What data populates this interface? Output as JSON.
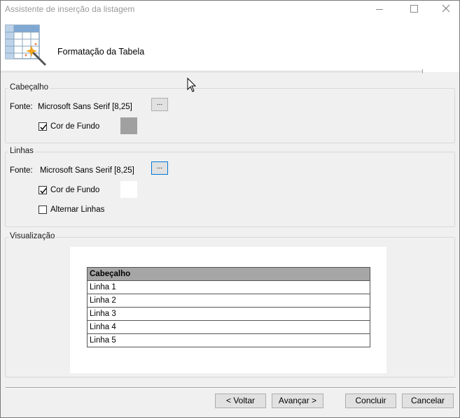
{
  "window": {
    "title": "Assistente de inserção da listagem"
  },
  "header": {
    "title": "Formatação da Tabela",
    "icon": "table-wizard-icon"
  },
  "cabecalho": {
    "group_label": "Cabeçalho",
    "font_label": "Fonte:",
    "font_value": "Microsoft Sans Serif [8,25]",
    "font_button": "...",
    "bg_checkbox_label": "Cor de Fundo",
    "bg_checked": true,
    "bg_color": "#a0a0a0"
  },
  "linhas": {
    "group_label": "Linhas",
    "font_label": "Fonte:",
    "font_value": "Microsoft Sans Serif [8,25]",
    "font_button": "...",
    "bg_checkbox_label": "Cor de Fundo",
    "bg_checked": true,
    "bg_color": "#ffffff",
    "alternate_label": "Alternar Linhas",
    "alternate_checked": false
  },
  "visualizacao": {
    "group_label": "Visualização",
    "table_header": "Cabeçalho",
    "rows": [
      "Linha 1",
      "Linha 2",
      "Linha 3",
      "Linha 4",
      "Linha 5"
    ]
  },
  "footer": {
    "back": "< Voltar",
    "next": "Avançar >",
    "finish": "Concluir",
    "cancel": "Cancelar"
  }
}
